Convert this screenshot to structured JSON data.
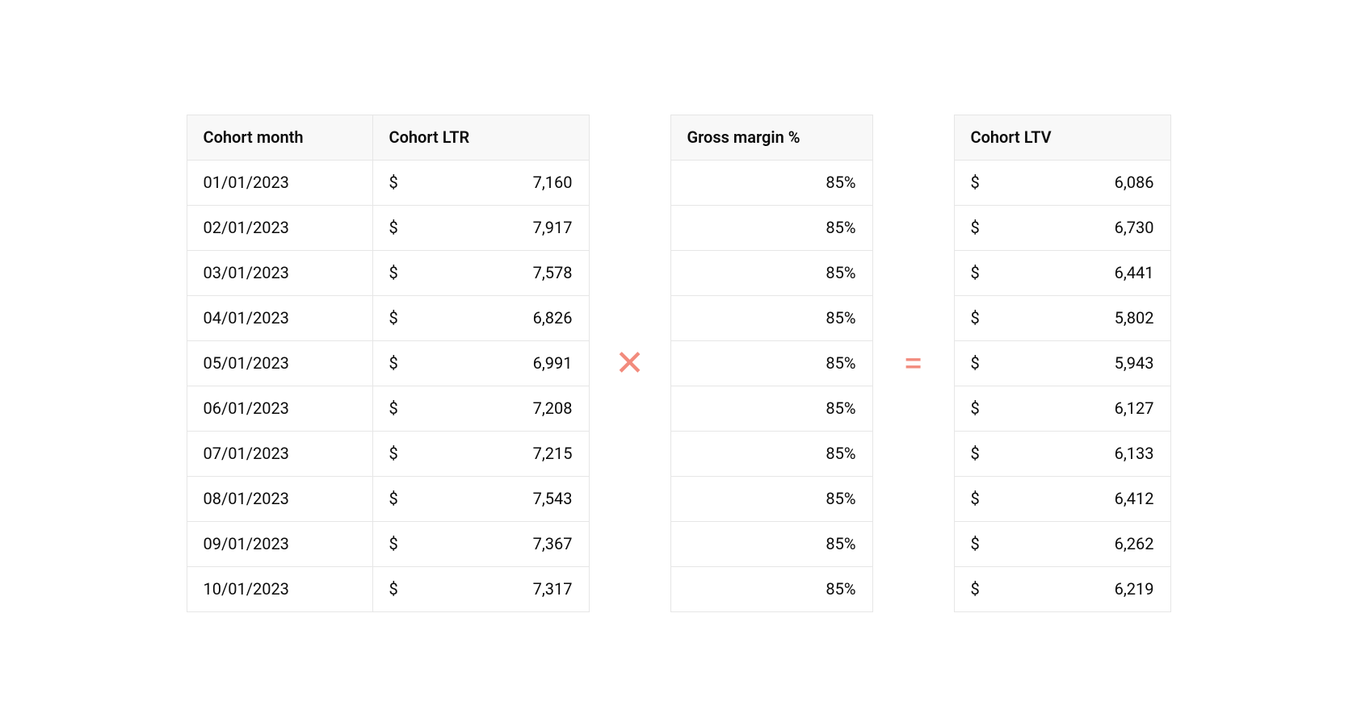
{
  "currency_symbol": "$",
  "operators": {
    "multiply": "✕",
    "equals": "="
  },
  "headers": {
    "cohort_month": "Cohort month",
    "cohort_ltr": "Cohort LTR",
    "gross_margin": "Gross margin %",
    "cohort_ltv": "Cohort LTV"
  },
  "rows": [
    {
      "month": "01/01/2023",
      "ltr": "7,160",
      "gm": "85%",
      "ltv": "6,086"
    },
    {
      "month": "02/01/2023",
      "ltr": "7,917",
      "gm": "85%",
      "ltv": "6,730"
    },
    {
      "month": "03/01/2023",
      "ltr": "7,578",
      "gm": "85%",
      "ltv": "6,441"
    },
    {
      "month": "04/01/2023",
      "ltr": "6,826",
      "gm": "85%",
      "ltv": "5,802"
    },
    {
      "month": "05/01/2023",
      "ltr": "6,991",
      "gm": "85%",
      "ltv": "5,943"
    },
    {
      "month": "06/01/2023",
      "ltr": "7,208",
      "gm": "85%",
      "ltv": "6,127"
    },
    {
      "month": "07/01/2023",
      "ltr": "7,215",
      "gm": "85%",
      "ltv": "6,133"
    },
    {
      "month": "08/01/2023",
      "ltr": "7,543",
      "gm": "85%",
      "ltv": "6,412"
    },
    {
      "month": "09/01/2023",
      "ltr": "7,367",
      "gm": "85%",
      "ltv": "6,262"
    },
    {
      "month": "10/01/2023",
      "ltr": "7,317",
      "gm": "85%",
      "ltv": "6,219"
    }
  ],
  "chart_data": {
    "type": "table",
    "title": "Cohort LTV = Cohort LTR × Gross margin %",
    "columns": [
      "Cohort month",
      "Cohort LTR",
      "Gross margin %",
      "Cohort LTV"
    ],
    "records": [
      [
        "01/01/2023",
        7160,
        0.85,
        6086
      ],
      [
        "02/01/2023",
        7917,
        0.85,
        6730
      ],
      [
        "03/01/2023",
        7578,
        0.85,
        6441
      ],
      [
        "04/01/2023",
        6826,
        0.85,
        5802
      ],
      [
        "05/01/2023",
        6991,
        0.85,
        5943
      ],
      [
        "06/01/2023",
        7208,
        0.85,
        6127
      ],
      [
        "07/01/2023",
        7215,
        0.85,
        6133
      ],
      [
        "08/01/2023",
        7543,
        0.85,
        6412
      ],
      [
        "09/01/2023",
        7367,
        0.85,
        6262
      ],
      [
        "10/01/2023",
        7317,
        0.85,
        6219
      ]
    ]
  }
}
